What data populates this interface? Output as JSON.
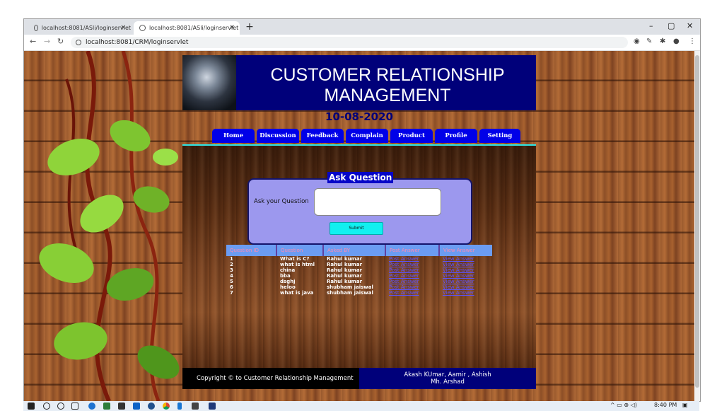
{
  "browser": {
    "tabs": [
      {
        "label": "localhost:8081/ASli/loginservlet",
        "active": false
      },
      {
        "label": "localhost:8081/ASli/loginservlet",
        "active": true
      }
    ],
    "close_glyph": "×",
    "new_tab_glyph": "+",
    "url": "localhost:8081/CRM/loginservlet",
    "window_controls": {
      "minimize": "–",
      "maximize": "▢",
      "close": "✕"
    }
  },
  "site": {
    "title_line1": "CUSTOMER RELATIONSHIP",
    "title_line2": "MANAGEMENT",
    "date": "10-08-2020",
    "nav": [
      "Home",
      "Discussion",
      "Feedback",
      "Complain",
      "Product",
      "Profile",
      "Setting"
    ],
    "ask": {
      "title": "Ask Question",
      "label": "Ask your Question",
      "submit": "Submit"
    },
    "table": {
      "headers": [
        "Question ID",
        "Question",
        "Asked BY",
        "Post Answer",
        "View Answer"
      ],
      "rows": [
        [
          "1",
          "What is C?",
          "Rahul kumar",
          "Post Answer",
          "View Answer"
        ],
        [
          "2",
          "what is html",
          "Rahul kumar",
          "Post Answer",
          "View Answer"
        ],
        [
          "3",
          "china",
          "Rahul kumar",
          "Post Answer",
          "View Answer"
        ],
        [
          "4",
          "bba",
          "Rahul kumar",
          "Post Answer",
          "View Answer"
        ],
        [
          "5",
          "dsghj",
          "Rahul kumar",
          "Post Answer",
          "View Answer"
        ],
        [
          "6",
          "heloo",
          "shubham jaiswal",
          "Post Answer",
          "View Answer"
        ],
        [
          "7",
          "what is java",
          "shubham jaiswal",
          "Post Answer",
          "View Answer"
        ]
      ]
    },
    "footer_left": "Copyright © to Customer Relationship Management",
    "footer_right_line1": "Akash KUmar, Aamir , Ashish",
    "footer_right_line2": "Mh. Arshad"
  },
  "taskbar": {
    "clock": "8:40 PM"
  },
  "colors": {
    "header_bg": "#00007a",
    "nav_bg": "#0000e8",
    "ask_box": "#9c98ee",
    "submit_bg": "#11f0f0",
    "table_header": "#6b9cf2"
  }
}
